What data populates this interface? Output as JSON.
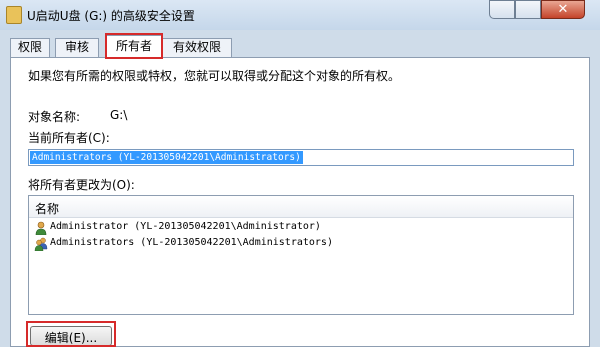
{
  "window": {
    "title": "U启动U盘 (G:) 的高级安全设置",
    "close_glyph": "✕"
  },
  "tabs": [
    {
      "label": "权限"
    },
    {
      "label": "审核"
    },
    {
      "label": "所有者",
      "active": true
    },
    {
      "label": "有效权限"
    }
  ],
  "info_text": "如果您有所需的权限或特权，您就可以取得或分配这个对象的所有权。",
  "object_name": {
    "label": "对象名称:",
    "value": "G:\\"
  },
  "current_owner": {
    "label": "当前所有者(C):",
    "value": "Administrators (YL-201305042201\\Administrators)"
  },
  "change_owner": {
    "label": "将所有者更改为(O):",
    "column_header": "名称",
    "items": [
      {
        "name": "Administrator (YL-201305042201\\Administrator)",
        "icon": "user-icon"
      },
      {
        "name": "Administrators (YL-201305042201\\Administrators)",
        "icon": "users-group-icon"
      }
    ]
  },
  "edit_button": {
    "label": "编辑(E)..."
  },
  "colors": {
    "highlight_red": "#d62a2a",
    "selection_blue": "#3399ff"
  }
}
